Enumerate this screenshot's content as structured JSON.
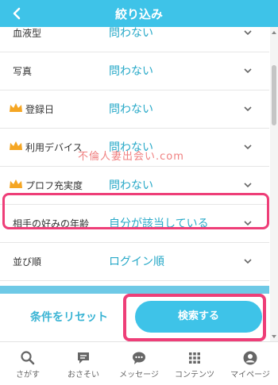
{
  "header": {
    "title": "絞り込み"
  },
  "filters": [
    {
      "label": "血液型",
      "value": "問わない",
      "premium": false
    },
    {
      "label": "写真",
      "value": "問わない",
      "premium": false
    },
    {
      "label": "登録日",
      "value": "問わない",
      "premium": true
    },
    {
      "label": "利用デバイス",
      "value": "問わない",
      "premium": true
    },
    {
      "label": "プロフ充実度",
      "value": "問わない",
      "premium": true
    },
    {
      "label": "相手の好みの年齢",
      "value": "自分が該当している",
      "premium": false
    },
    {
      "label": "並び順",
      "value": "ログイン順",
      "premium": false
    }
  ],
  "watermark": "不倫人妻出会い.com",
  "footer": {
    "reset_label": "条件をリセット",
    "search_label": "検索する"
  },
  "tabbar": [
    {
      "label": "さがす",
      "icon": "search-icon"
    },
    {
      "label": "おさそい",
      "icon": "invite-icon"
    },
    {
      "label": "メッセージ",
      "icon": "message-icon"
    },
    {
      "label": "コンテンツ",
      "icon": "grid-icon"
    },
    {
      "label": "マイページ",
      "icon": "user-icon"
    }
  ],
  "colors": {
    "accent": "#3ec3e8",
    "value_text": "#28a9c8",
    "highlight": "#ee3e78",
    "crown": "#f5a623"
  }
}
